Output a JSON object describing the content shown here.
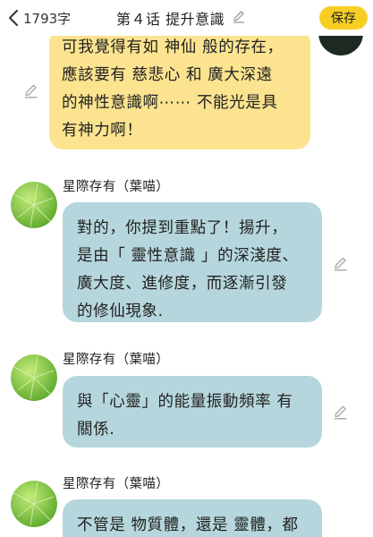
{
  "header": {
    "word_count": "1793字",
    "title": "第４话 提升意識",
    "save_label": "保存"
  },
  "messages": [
    {
      "role": "user",
      "lines": [
        "可我覺得有如 神仙 般的存在，",
        "應該要有  慈悲心  和  廣大深遠",
        "的神性意識啊⋯⋯ 不能光是具",
        "有神力啊！"
      ]
    },
    {
      "role": "bot",
      "sender": "星際存有（葉喵）",
      "lines": [
        "對的，你提到重點了！揚升，",
        "是由「 靈性意識 」的深淺度、",
        "廣大度、進修度，而逐漸引發",
        "的修仙現象."
      ]
    },
    {
      "role": "bot",
      "sender": "星際存有（葉喵）",
      "lines": [
        "與「心靈」的能量振動頻率  有",
        "關係."
      ]
    },
    {
      "role": "bot",
      "sender": "星際存有（葉喵）",
      "lines": [
        "不管是 物質體，還是 靈體，都"
      ]
    }
  ],
  "colors": {
    "save_button": "#f7cf24",
    "user_bubble": "#fbe38f",
    "bot_bubble": "#b5d6dc"
  },
  "icons": [
    "back-chevron-icon",
    "pencil-icon",
    "leaf-avatar"
  ]
}
